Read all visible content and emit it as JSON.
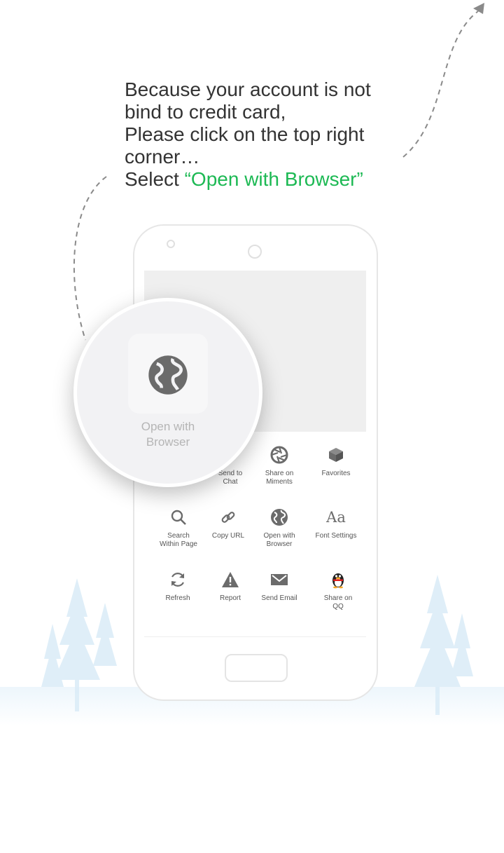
{
  "guide": {
    "line1": "Because your account is not",
    "line2": "bind to credit card,",
    "line3": "Please click on the top right",
    "line4": "corner…",
    "line5_prefix": "Select ",
    "line5_highlight": "“Open with Browser”",
    "highlight_color": "#1db954"
  },
  "magnifier": {
    "label_line1": "Open with",
    "label_line2": "Browser",
    "icon": "globe-icon"
  },
  "menu": {
    "row1": [
      {
        "label1": "Send to",
        "label2": "Chat",
        "icon": "chat-icon"
      },
      {
        "label1": "Share on",
        "label2": "Miments",
        "icon": "moments-shutter-icon"
      },
      {
        "label1": "Favorites",
        "label2": "",
        "icon": "cube-icon"
      }
    ],
    "row2": [
      {
        "label1": "Search",
        "label2": "Within Page",
        "icon": "search-icon"
      },
      {
        "label1": "Copy URL",
        "label2": "",
        "icon": "link-icon"
      },
      {
        "label1": "Open with",
        "label2": "Browser",
        "icon": "globe-icon"
      },
      {
        "label1": "Font Settings",
        "label2": "",
        "icon": "font-icon"
      }
    ],
    "row3": [
      {
        "label1": "Refresh",
        "label2": "",
        "icon": "refresh-icon"
      },
      {
        "label1": "Report",
        "label2": "",
        "icon": "warning-icon"
      },
      {
        "label1": "Send Email",
        "label2": "",
        "icon": "mail-icon"
      },
      {
        "label1": "Share on",
        "label2": "QQ",
        "icon": "qq-penguin-icon"
      }
    ],
    "font_icon_text": "Aa"
  },
  "colors": {
    "icon_gray": "#6b6b6b",
    "tree": "#d9ecf8"
  }
}
